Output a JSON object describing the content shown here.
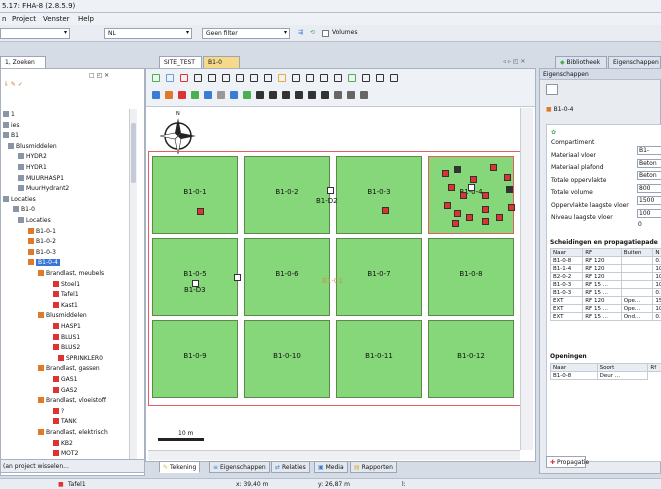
{
  "window": {
    "title": "5.17: FHA-8 (2.8.5.9)"
  },
  "menu": {
    "items": [
      "n",
      "Project",
      "Venster",
      "Help"
    ]
  },
  "filterbar": {
    "layer_value": "NL",
    "filter_value": "Geen filter",
    "volumes_label": "Volumes"
  },
  "left_panel": {
    "tab_label": "1, Zoeken",
    "tree": [
      {
        "label": "1",
        "indent": 0
      },
      {
        "label": "ies",
        "indent": 0
      },
      {
        "label": "B1",
        "indent": 0
      },
      {
        "label": "Blusmiddelen",
        "indent": 1
      },
      {
        "label": "HYDR2",
        "indent": 3
      },
      {
        "label": "HYDR1",
        "indent": 3
      },
      {
        "label": "MUURHASP1",
        "indent": 3
      },
      {
        "label": "MuurHydrant2",
        "indent": 3
      },
      {
        "label": "Locaties",
        "indent": 0
      },
      {
        "label": "B1-0",
        "indent": 2
      },
      {
        "label": "Locaties",
        "indent": 3
      },
      {
        "label": "B1-0-1",
        "indent": 5
      },
      {
        "label": "B1-0-2",
        "indent": 5
      },
      {
        "label": "B1-0-3",
        "indent": 5
      },
      {
        "label": "B1-0-4",
        "indent": 5
      },
      {
        "label": "Brandlast, meubels",
        "indent": 7
      },
      {
        "label": "Stoel1",
        "indent": 10
      },
      {
        "label": "Tafel1",
        "indent": 10
      },
      {
        "label": "Kast1",
        "indent": 10
      },
      {
        "label": "Blusmiddelen",
        "indent": 7
      },
      {
        "label": "HASP1",
        "indent": 10
      },
      {
        "label": "BLUS1",
        "indent": 10
      },
      {
        "label": "BLUS2",
        "indent": 10
      },
      {
        "label": "SPRINKLER0",
        "indent": 11
      },
      {
        "label": "Brandlast, gassen",
        "indent": 7
      },
      {
        "label": "GAS1",
        "indent": 10
      },
      {
        "label": "GAS2",
        "indent": 10
      },
      {
        "label": "Brandlast, vloeistoff",
        "indent": 7
      },
      {
        "label": "?",
        "indent": 10
      },
      {
        "label": "TANK",
        "indent": 10
      },
      {
        "label": "Brandlast, elektrisch",
        "indent": 7
      },
      {
        "label": "KB2",
        "indent": 10
      },
      {
        "label": "MOT2",
        "indent": 10
      },
      {
        "label": "?",
        "indent": 10
      }
    ],
    "bottom_label": "(an project wisselen..."
  },
  "editor": {
    "tabs": [
      "SITE_TEST",
      "B1-0"
    ],
    "scale_label": "10 m",
    "compass_label": "N",
    "rooms": [
      "B1-0-1",
      "B1-0-2",
      "B1-0-3",
      "B1-0-4",
      "B1-0-5",
      "B1-0-6",
      "B1-0-7",
      "B1-0-8",
      "B1-0-9",
      "B1-0-10",
      "B1-0-11",
      "B1-0-12"
    ],
    "extra_labels": {
      "d2": "B1-D2",
      "d3": "B1-D3",
      "c1": "B1-C1"
    },
    "bottom_tabs": [
      "Tekening",
      "Eigenschappen",
      "Relaties",
      "Media",
      "Rapporten"
    ]
  },
  "right_panel": {
    "tabs": [
      "Bibliotheek",
      "Eigenschappen"
    ],
    "header": "Eigenschappen",
    "object": "B1-0-4",
    "properties": [
      {
        "label": "Compartiment",
        "value": "B1-"
      },
      {
        "label": "Materiaal vloer",
        "value": "Beton"
      },
      {
        "label": "Materiaal plafond",
        "value": "Beton"
      },
      {
        "label": "Totale oppervlakte",
        "value": "800"
      },
      {
        "label": "Totale volume",
        "value": "1500"
      },
      {
        "label": "Oppervlakte laagste vloer",
        "value": "100"
      },
      {
        "label": "Niveau laagste vloer",
        "value": "0"
      }
    ],
    "scheidingen_title": "Scheidingen en propagatiepade",
    "scheidingen_headers": [
      "Naar",
      "RF",
      "Buiten",
      "N"
    ],
    "scheidingen_rows": [
      [
        "B1-0-8",
        "RF 120",
        "",
        "0."
      ],
      [
        "B1-1-4",
        "RF 120",
        "",
        "10"
      ],
      [
        "B2-0-2",
        "RF 120",
        "",
        "10"
      ],
      [
        "B1-0-3",
        "RF 15 ...",
        "",
        "10"
      ],
      [
        "B1-0-3",
        "RF 15 ...",
        "",
        "0."
      ],
      [
        "EXT",
        "RF 120",
        "Ope...",
        "15"
      ],
      [
        "EXT",
        "RF 15 ...",
        "Ope...",
        "10"
      ],
      [
        "EXT",
        "RF 15 ...",
        "Ond...",
        "0."
      ]
    ],
    "openingen_title": "Openingen",
    "openingen_headers": [
      "Naar",
      "Soort",
      "Rf"
    ],
    "openingen_rows": [
      [
        "B1-0-8",
        "Deur ..."
      ]
    ],
    "bottom_tab": "Propagatie"
  },
  "status": {
    "item": "Tafel1",
    "x": "x: 39,40 m",
    "y": "y: 26,87 m",
    "l": "l:"
  },
  "colors": {
    "room_fill": "#86d67a",
    "selection": "#3875d7",
    "boundary": "#e06060"
  }
}
